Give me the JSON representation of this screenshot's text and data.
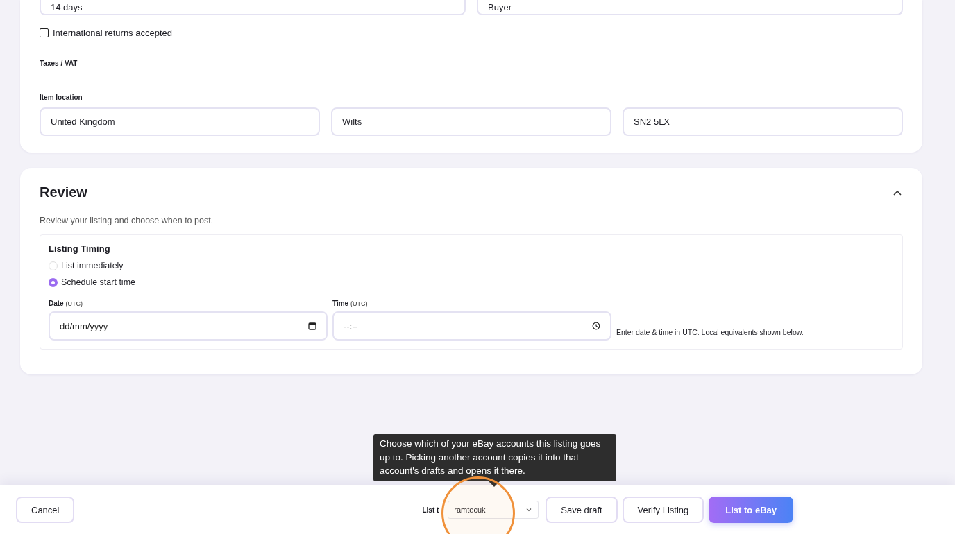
{
  "returns_fields": [
    {
      "value": "14 days"
    },
    {
      "value": "Buyer"
    }
  ],
  "international_returns": {
    "label": "International returns accepted",
    "checked": false
  },
  "taxes_label": "Taxes / VAT",
  "item_location": {
    "label": "Item location",
    "fields": [
      "United Kingdom",
      "Wilts",
      "SN2 5LX"
    ]
  },
  "review": {
    "title": "Review",
    "expanded": true,
    "description": "Review your listing and choose when to post.",
    "timing": {
      "title": "Listing Timing",
      "options": [
        {
          "label": "List immediately",
          "selected": false
        },
        {
          "label": "Schedule start time",
          "selected": true
        }
      ],
      "date": {
        "label": "Date",
        "unit": "(UTC)",
        "placeholder": "dd/mm/yyyy"
      },
      "time": {
        "label": "Time",
        "unit": "(UTC)",
        "placeholder": "--:--"
      },
      "hint": "Enter date & time in UTC. Local equivalents shown below."
    }
  },
  "footer": {
    "cancel": "Cancel",
    "account_label": "List t",
    "account": "ramtecuk",
    "buttons": [
      "Save draft",
      "Verify Listing"
    ],
    "primary": "List to eBay",
    "tooltip": "Choose which of your eBay accounts this listing goes up to. Picking another account copies it into that account's drafts and opens it there."
  }
}
